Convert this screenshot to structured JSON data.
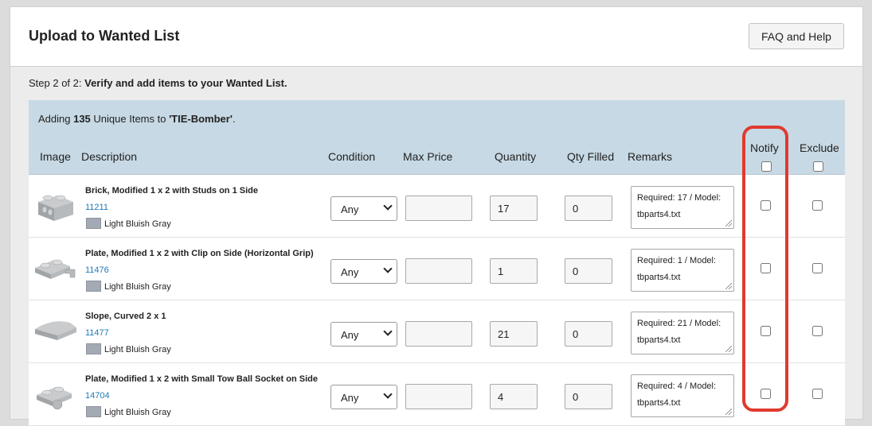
{
  "header": {
    "title": "Upload to Wanted List",
    "faq_label": "FAQ and Help"
  },
  "step": {
    "prefix": "Step 2 of 2: ",
    "text": "Verify and add items to your Wanted List."
  },
  "summary": {
    "prefix": "Adding ",
    "count": "135",
    "middle": " Unique Items to ",
    "list_name": "'TIE-Bomber'",
    "suffix": "."
  },
  "columns": {
    "image": "Image",
    "description": "Description",
    "condition": "Condition",
    "max_price": "Max Price",
    "quantity": "Quantity",
    "qty_filled": "Qty Filled",
    "remarks": "Remarks",
    "notify": "Notify",
    "exclude": "Exclude"
  },
  "rows": [
    {
      "description": "Brick, Modified 1 x 2 with Studs on 1 Side",
      "item_no": "11211",
      "color": "Light Bluish Gray",
      "condition": "Any",
      "max_price": "",
      "quantity": "17",
      "qty_filled": "0",
      "remarks_line1": "Required: 17 / Model:",
      "remarks_line2": "tbparts4.txt",
      "part_icon": "brick-icon"
    },
    {
      "description": "Plate, Modified 1 x 2 with Clip on Side (Horizontal Grip)",
      "item_no": "11476",
      "color": "Light Bluish Gray",
      "condition": "Any",
      "max_price": "",
      "quantity": "1",
      "qty_filled": "0",
      "remarks_line1": "Required: 1 / Model:",
      "remarks_line2": "tbparts4.txt",
      "part_icon": "plate-clip-icon"
    },
    {
      "description": "Slope, Curved 2 x 1",
      "item_no": "11477",
      "color": "Light Bluish Gray",
      "condition": "Any",
      "max_price": "",
      "quantity": "21",
      "qty_filled": "0",
      "remarks_line1": "Required: 21 / Model:",
      "remarks_line2": "tbparts4.txt",
      "part_icon": "slope-icon"
    },
    {
      "description": "Plate, Modified 1 x 2 with Small Tow Ball Socket on Side",
      "item_no": "14704",
      "color": "Light Bluish Gray",
      "condition": "Any",
      "max_price": "",
      "quantity": "4",
      "qty_filled": "0",
      "remarks_line1": "Required: 4 / Model:",
      "remarks_line2": "tbparts4.txt",
      "part_icon": "plate-socket-icon"
    }
  ],
  "colors": {
    "header_band": "#c7d9e4",
    "link": "#1f7ab8",
    "highlight": "#e03a30",
    "swatch_light_bluish_gray": "#a3aab4"
  }
}
